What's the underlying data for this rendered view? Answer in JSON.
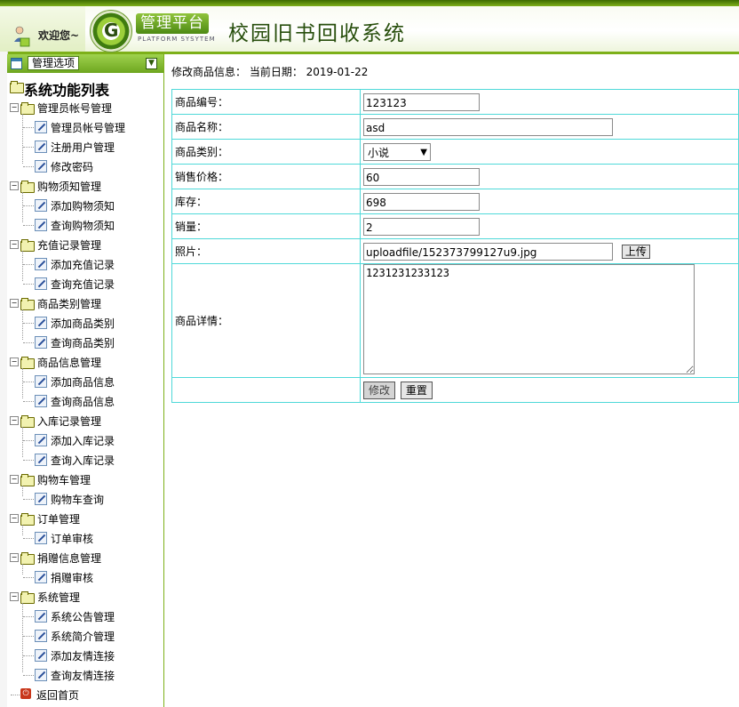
{
  "header": {
    "welcome": "欢迎您~",
    "logo_letter": "G",
    "platform_badge": "管理平台",
    "platform_sub": "PLATFORM SYSYTEM",
    "system_title": "校园旧书回收系统"
  },
  "sidebar": {
    "header_label": "管理选项",
    "root": "系统功能列表",
    "groups": [
      {
        "label": "管理员帐号管理",
        "items": [
          "管理员帐号管理",
          "注册用户管理",
          "修改密码"
        ]
      },
      {
        "label": "购物须知管理",
        "items": [
          "添加购物须知",
          "查询购物须知"
        ]
      },
      {
        "label": "充值记录管理",
        "items": [
          "添加充值记录",
          "查询充值记录"
        ]
      },
      {
        "label": "商品类别管理",
        "items": [
          "添加商品类别",
          "查询商品类别"
        ]
      },
      {
        "label": "商品信息管理",
        "items": [
          "添加商品信息",
          "查询商品信息"
        ]
      },
      {
        "label": "入库记录管理",
        "items": [
          "添加入库记录",
          "查询入库记录"
        ]
      },
      {
        "label": "购物车管理",
        "items": [
          "购物车查询"
        ]
      },
      {
        "label": "订单管理",
        "items": [
          "订单审核"
        ]
      },
      {
        "label": "捐赠信息管理",
        "items": [
          "捐赠审核"
        ]
      },
      {
        "label": "系统管理",
        "items": [
          "系统公告管理",
          "系统简介管理",
          "添加友情连接",
          "查询友情连接"
        ]
      }
    ],
    "home_link": "返回首页"
  },
  "main": {
    "crumb": "修改商品信息： 当前日期： 2019-01-22",
    "form": {
      "code_label": "商品编号：",
      "code_value": "123123",
      "name_label": "商品名称：",
      "name_value": "asd",
      "category_label": "商品类别：",
      "category_value": "小说",
      "price_label": "销售价格：",
      "price_value": "60",
      "stock_label": "库存：",
      "stock_value": "698",
      "sales_label": "销量：",
      "sales_value": "2",
      "photo_label": "照片：",
      "photo_value": "uploadfile/152373799127u9.jpg",
      "upload_button": "上传",
      "detail_label": "商品详情：",
      "detail_value": "1231231233123",
      "submit_button": "修改",
      "reset_button": "重置"
    }
  }
}
